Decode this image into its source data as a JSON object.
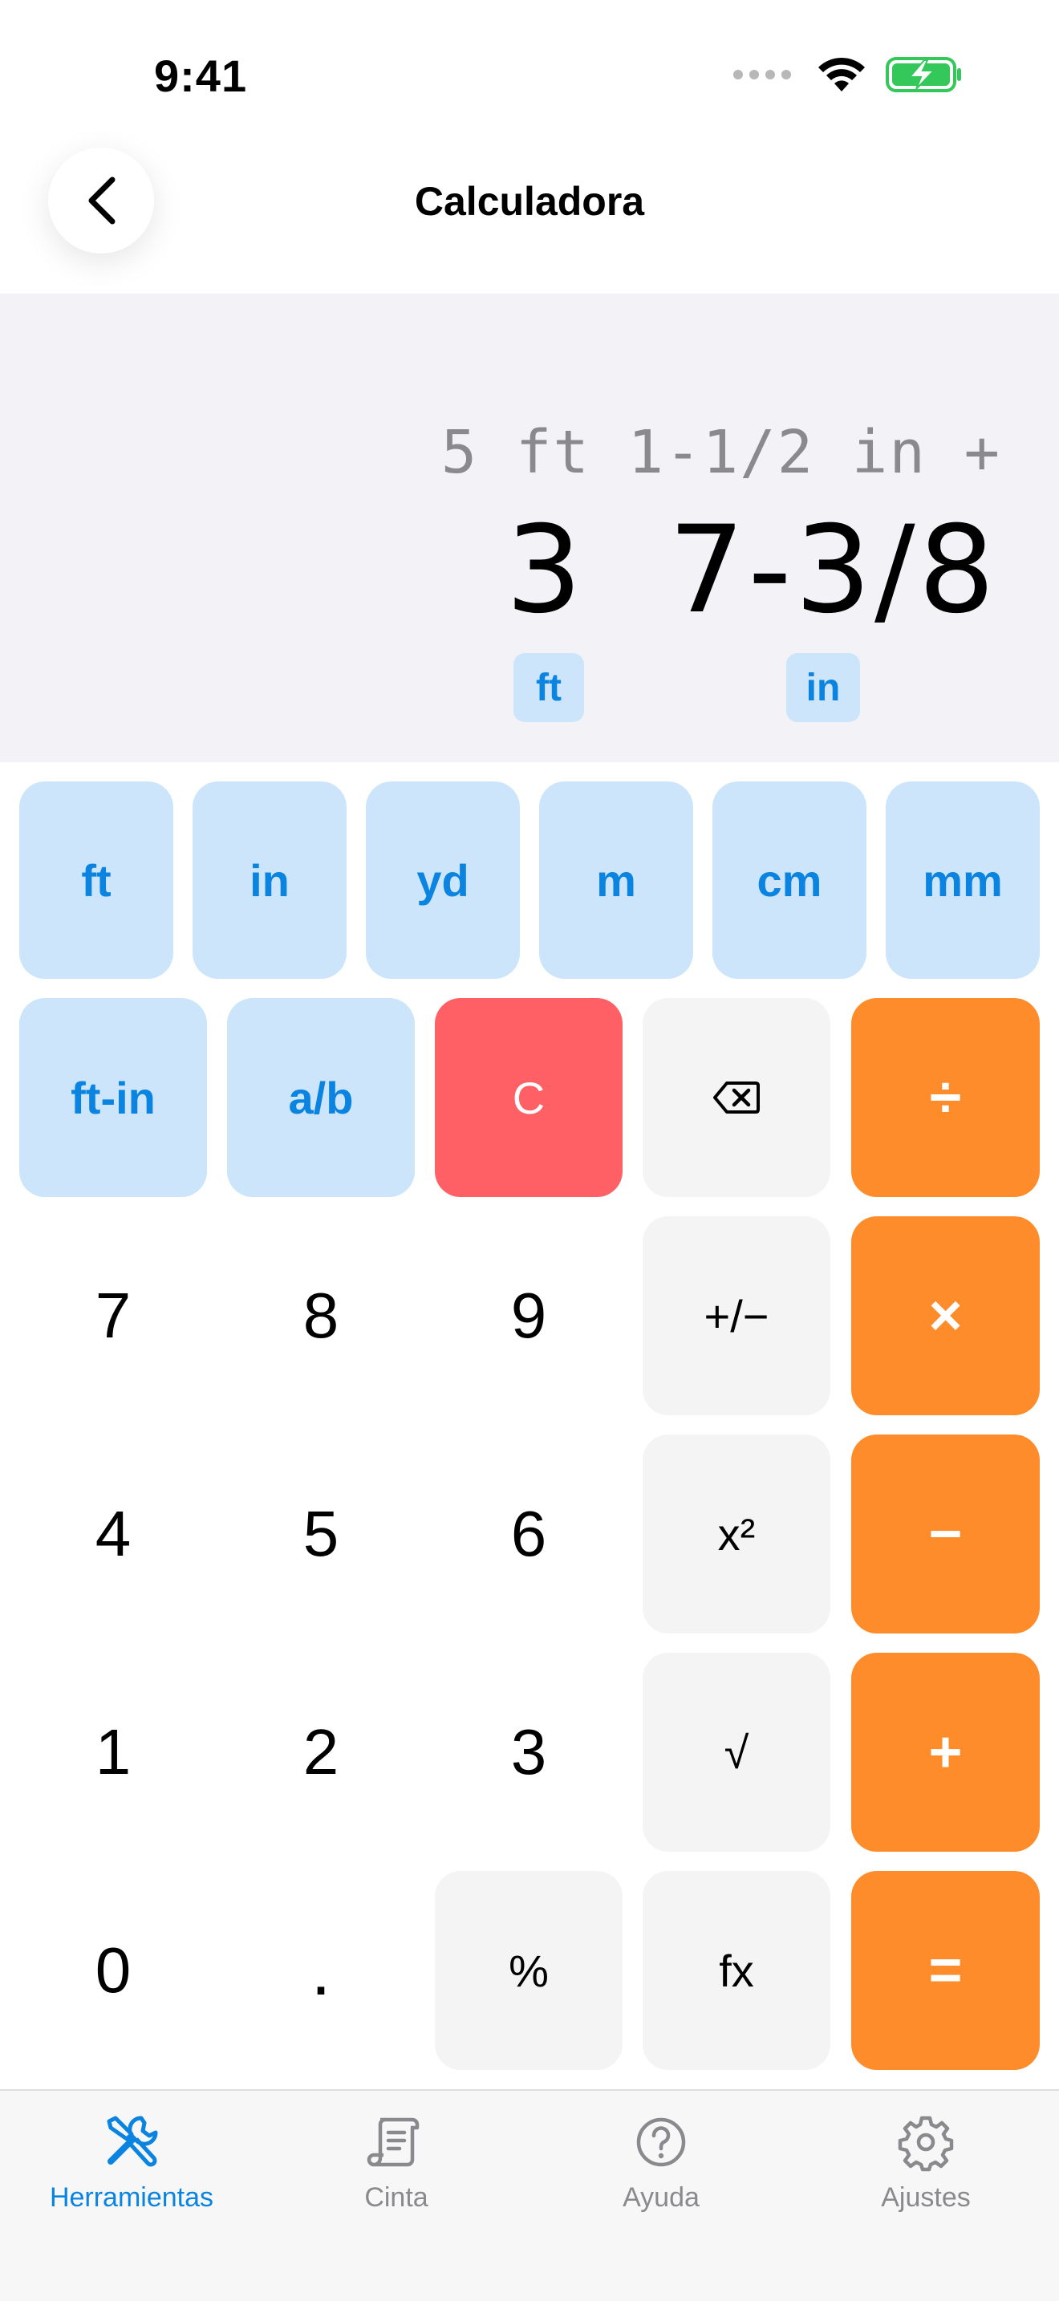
{
  "status_bar": {
    "time": "9:41"
  },
  "header": {
    "title": "Calculadora"
  },
  "display": {
    "expression": "5 ft 1-1/2 in +",
    "feet_value": "3",
    "inches_value": "7-3/8",
    "feet_unit": "ft",
    "inches_unit": "in"
  },
  "units_row": [
    "ft",
    "in",
    "yd",
    "m",
    "cm",
    "mm"
  ],
  "keys": {
    "ft_in": "ft-in",
    "fraction": "a/b",
    "clear": "C",
    "divide": "÷",
    "multiply": "×",
    "subtract": "−",
    "add": "+",
    "equals": "=",
    "plus_minus": "+/−",
    "square": "x²",
    "sqrt": "√",
    "percent": "%",
    "fx": "fx",
    "seven": "7",
    "eight": "8",
    "nine": "9",
    "four": "4",
    "five": "5",
    "six": "6",
    "one": "1",
    "two": "2",
    "three": "3",
    "zero": "0",
    "decimal": "."
  },
  "tabs": [
    {
      "label": "Herramientas",
      "icon": "tools-icon",
      "active": true
    },
    {
      "label": "Cinta",
      "icon": "scroll-icon",
      "active": false
    },
    {
      "label": "Ayuda",
      "icon": "help-icon",
      "active": false
    },
    {
      "label": "Ajustes",
      "icon": "gear-icon",
      "active": false
    }
  ],
  "colors": {
    "accent_blue": "#0a84e0",
    "unit_key_bg": "#cce5fa",
    "operator_orange": "#ff8c2b",
    "clear_red": "#ff6066",
    "function_gray": "#f4f4f4",
    "display_bg": "#f2f2f7",
    "battery_green": "#34c759"
  }
}
